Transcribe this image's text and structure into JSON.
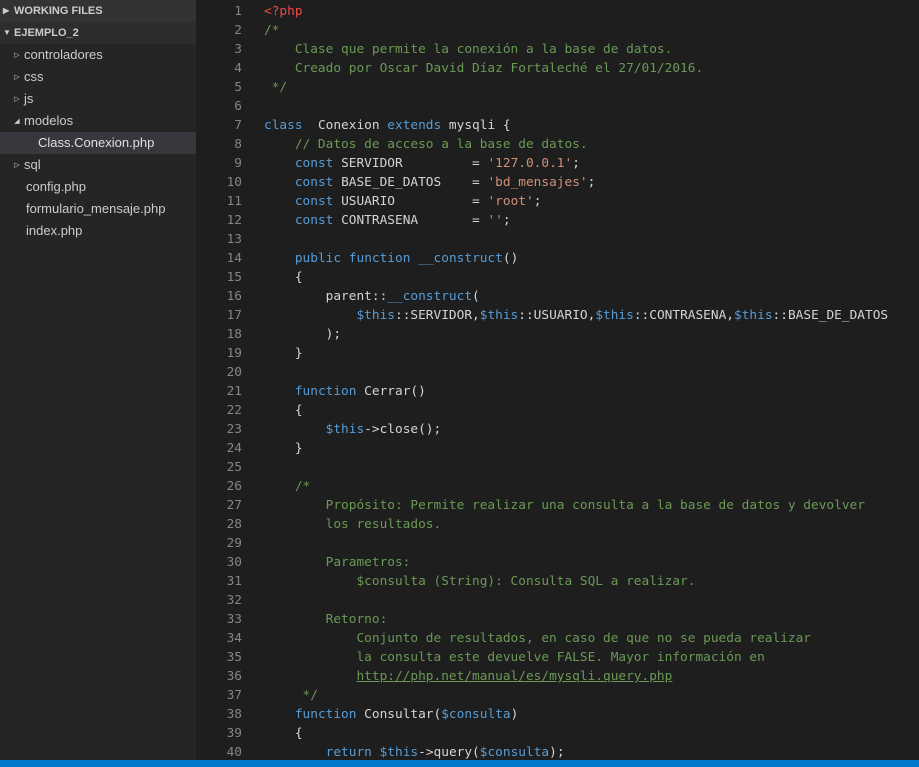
{
  "sidebar": {
    "working_files": "WORKING FILES",
    "project": "EJEMPLO_2",
    "items": [
      {
        "label": "controladores",
        "type": "folder",
        "expanded": false,
        "depth": 1
      },
      {
        "label": "css",
        "type": "folder",
        "expanded": false,
        "depth": 1
      },
      {
        "label": "js",
        "type": "folder",
        "expanded": false,
        "depth": 1
      },
      {
        "label": "modelos",
        "type": "folder",
        "expanded": true,
        "depth": 1
      },
      {
        "label": "Class.Conexion.php",
        "type": "file",
        "selected": true,
        "depth": 2
      },
      {
        "label": "sql",
        "type": "folder",
        "expanded": false,
        "depth": 1
      },
      {
        "label": "config.php",
        "type": "file",
        "depth": 1
      },
      {
        "label": "formulario_mensaje.php",
        "type": "file",
        "depth": 1
      },
      {
        "label": "index.php",
        "type": "file",
        "depth": 1
      }
    ]
  },
  "editor": {
    "lines": [
      [
        [
          "php",
          "<?php"
        ]
      ],
      [
        [
          "cm",
          "/*"
        ]
      ],
      [
        [
          "cm",
          "    Clase que permite la conexión a la base de datos."
        ]
      ],
      [
        [
          "cm",
          "    Creado por Oscar David Díaz Fortaleché el 27/01/2016."
        ]
      ],
      [
        [
          "cm",
          " */"
        ]
      ],
      [],
      [
        [
          "kw",
          "class"
        ],
        [
          "",
          "  Conexion "
        ],
        [
          "kw",
          "extends"
        ],
        [
          "",
          " mysqli {"
        ]
      ],
      [
        [
          "cm",
          "    // Datos de acceso a la base de datos."
        ]
      ],
      [
        [
          "",
          "    "
        ],
        [
          "kw",
          "const"
        ],
        [
          "",
          " SERVIDOR         = "
        ],
        [
          "str",
          "'127.0.0.1'"
        ],
        [
          "",
          ";"
        ]
      ],
      [
        [
          "",
          "    "
        ],
        [
          "kw",
          "const"
        ],
        [
          "",
          " BASE_DE_DATOS    = "
        ],
        [
          "str",
          "'bd_mensajes'"
        ],
        [
          "",
          ";"
        ]
      ],
      [
        [
          "",
          "    "
        ],
        [
          "kw",
          "const"
        ],
        [
          "",
          " USUARIO          = "
        ],
        [
          "str",
          "'root'"
        ],
        [
          "",
          ";"
        ]
      ],
      [
        [
          "",
          "    "
        ],
        [
          "kw",
          "const"
        ],
        [
          "",
          " CONTRASENA       = "
        ],
        [
          "str",
          "''"
        ],
        [
          "",
          ";"
        ]
      ],
      [],
      [
        [
          "",
          "    "
        ],
        [
          "kw",
          "public"
        ],
        [
          "",
          " "
        ],
        [
          "kw",
          "function"
        ],
        [
          "",
          " "
        ],
        [
          "kw",
          "__construct"
        ],
        [
          "",
          "()"
        ]
      ],
      [
        [
          "",
          "    {"
        ]
      ],
      [
        [
          "",
          "        parent::"
        ],
        [
          "kw",
          "__construct"
        ],
        [
          "",
          "("
        ]
      ],
      [
        [
          "",
          "            "
        ],
        [
          "var",
          "$this"
        ],
        [
          "",
          "::SERVIDOR,"
        ],
        [
          "var",
          "$this"
        ],
        [
          "",
          "::USUARIO,"
        ],
        [
          "var",
          "$this"
        ],
        [
          "",
          "::CONTRASENA,"
        ],
        [
          "var",
          "$this"
        ],
        [
          "",
          "::BASE_DE_DATOS"
        ]
      ],
      [
        [
          "",
          "        );"
        ]
      ],
      [
        [
          "",
          "    }"
        ]
      ],
      [],
      [
        [
          "",
          "    "
        ],
        [
          "kw",
          "function"
        ],
        [
          "",
          " Cerrar()"
        ]
      ],
      [
        [
          "",
          "    {"
        ]
      ],
      [
        [
          "",
          "        "
        ],
        [
          "var",
          "$this"
        ],
        [
          "",
          "->close();"
        ]
      ],
      [
        [
          "",
          "    }"
        ]
      ],
      [],
      [
        [
          "cm",
          "    /*"
        ]
      ],
      [
        [
          "cm",
          "        Propósito: Permite realizar una consulta a la base de datos y devolver"
        ]
      ],
      [
        [
          "cm",
          "        los resultados."
        ]
      ],
      [],
      [
        [
          "cm",
          "        Parametros:"
        ]
      ],
      [
        [
          "cm",
          "            $consulta (String): Consulta SQL a realizar."
        ]
      ],
      [],
      [
        [
          "cm",
          "        Retorno:"
        ]
      ],
      [
        [
          "cm",
          "            Conjunto de resultados, en caso de que no se pueda realizar"
        ]
      ],
      [
        [
          "cm",
          "            la consulta este devuelve FALSE. Mayor información en"
        ]
      ],
      [
        [
          "cm",
          "            "
        ],
        [
          "lnk",
          "http://php.net/manual/es/mysqli.query.php"
        ]
      ],
      [
        [
          "cm",
          "     */"
        ]
      ],
      [
        [
          "",
          "    "
        ],
        [
          "kw",
          "function"
        ],
        [
          "",
          " Consultar("
        ],
        [
          "var",
          "$consulta"
        ],
        [
          "",
          ")"
        ]
      ],
      [
        [
          "",
          "    {"
        ]
      ],
      [
        [
          "",
          "        "
        ],
        [
          "kw",
          "return"
        ],
        [
          "",
          " "
        ],
        [
          "var",
          "$this"
        ],
        [
          "",
          "->query("
        ],
        [
          "var",
          "$consulta"
        ],
        [
          "",
          ");"
        ]
      ]
    ]
  }
}
